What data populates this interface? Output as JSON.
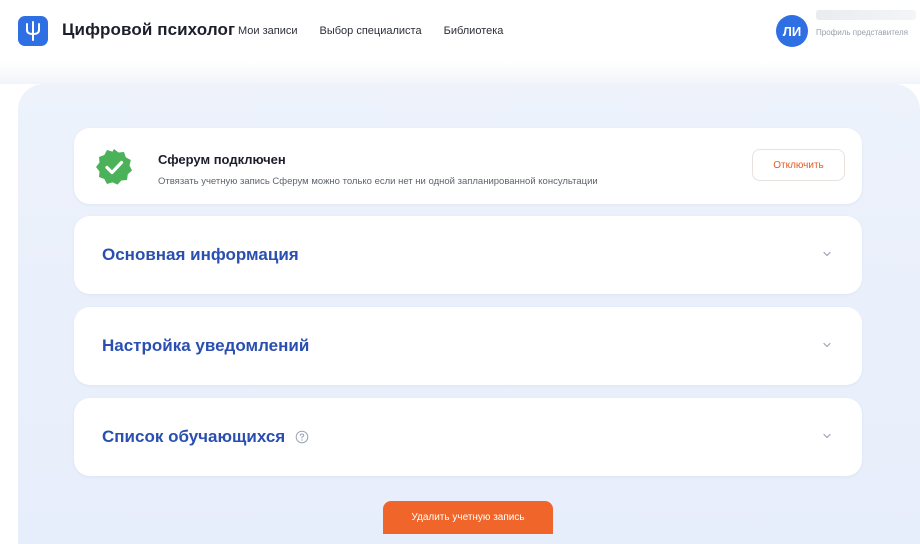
{
  "header": {
    "brand": "Цифровой психолог",
    "nav": [
      "Мои записи",
      "Выбор специалиста",
      "Библиотека"
    ],
    "avatar_initials": "ЛИ",
    "profile_label": "Профиль представителя"
  },
  "sferum": {
    "title": "Сферум подключен",
    "description": "Отвязать учетную запись Сферум можно только если нет ни одной запланированной консультации",
    "disconnect_label": "Отключить"
  },
  "accordions": [
    {
      "title": "Основная информация"
    },
    {
      "title": "Настройка уведомлений"
    },
    {
      "title": "Список обучающихся"
    }
  ],
  "delete_label": "Удалить учетную запись",
  "colors": {
    "accent_blue": "#2f6fe4",
    "title_blue": "#2a4fb0",
    "success_green": "#4cb25a",
    "orange": "#f0662a"
  },
  "icons": {
    "logo": "psi-logo-icon",
    "check": "check-badge-icon",
    "chevron": "chevron-down-icon",
    "help": "help-icon"
  }
}
